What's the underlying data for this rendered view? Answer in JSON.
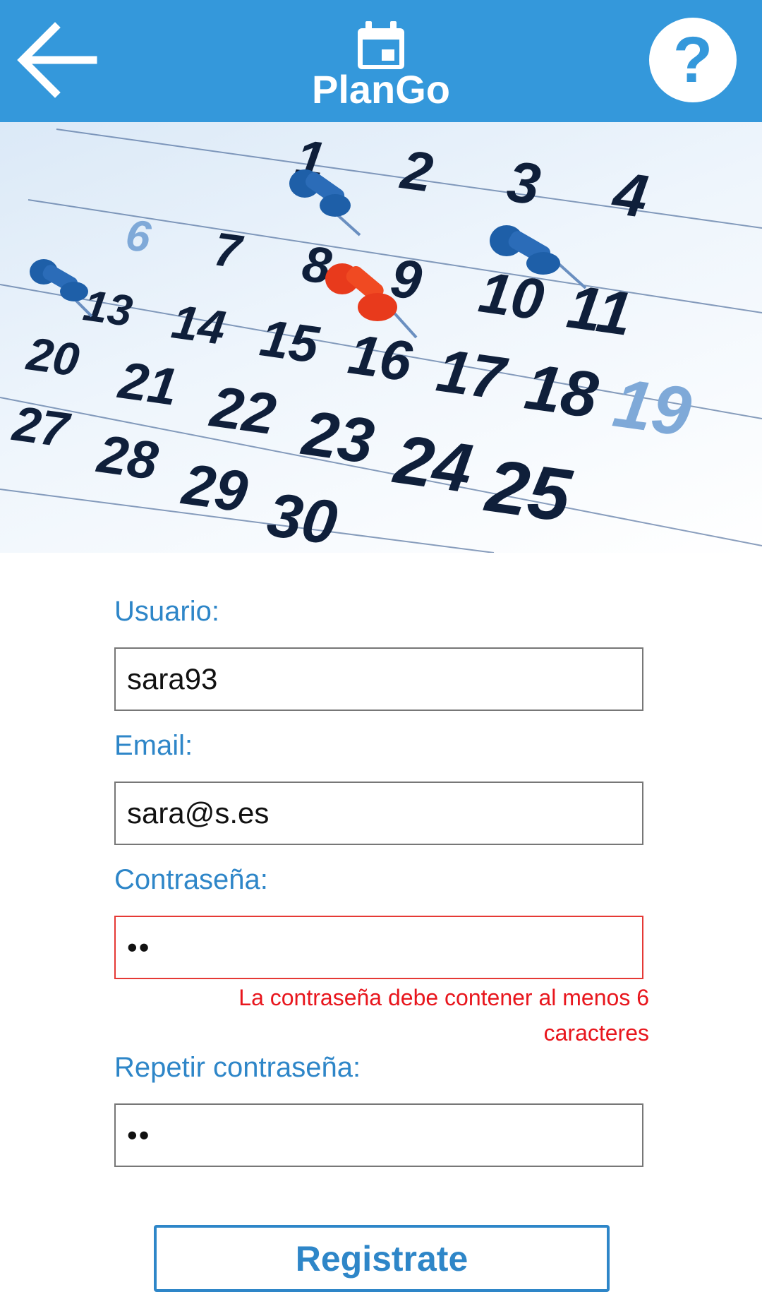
{
  "header": {
    "title": "PlanGo",
    "back_icon": "arrow-left-icon",
    "title_icon": "calendar-icon",
    "help_icon": "help-icon",
    "help_label": "?"
  },
  "hero": {
    "image": "calendar-with-pushpins",
    "rows": [
      [
        "",
        "1",
        "2",
        "3",
        "4"
      ],
      [
        "6",
        "7",
        "8",
        "9",
        "10",
        "11"
      ],
      [
        "13",
        "14",
        "15",
        "16",
        "17",
        "18",
        "19"
      ],
      [
        "20",
        "21",
        "22",
        "23",
        "24",
        "25"
      ],
      [
        "27",
        "28",
        "29",
        "30"
      ]
    ]
  },
  "form": {
    "username": {
      "label": "Usuario:",
      "value": "sara93"
    },
    "email": {
      "label": "Email:",
      "value": "sara@s.es"
    },
    "password": {
      "label": "Contraseña:",
      "value": "••",
      "error": "La contraseña debe contener al menos 6 caracteres"
    },
    "repeat_password": {
      "label": "Repetir contraseña:",
      "value": "••"
    },
    "submit_label": "Registrate"
  },
  "colors": {
    "primary": "#3498db",
    "label": "#2e86c8",
    "error": "#e8161d",
    "header_text": "#ffffff"
  }
}
